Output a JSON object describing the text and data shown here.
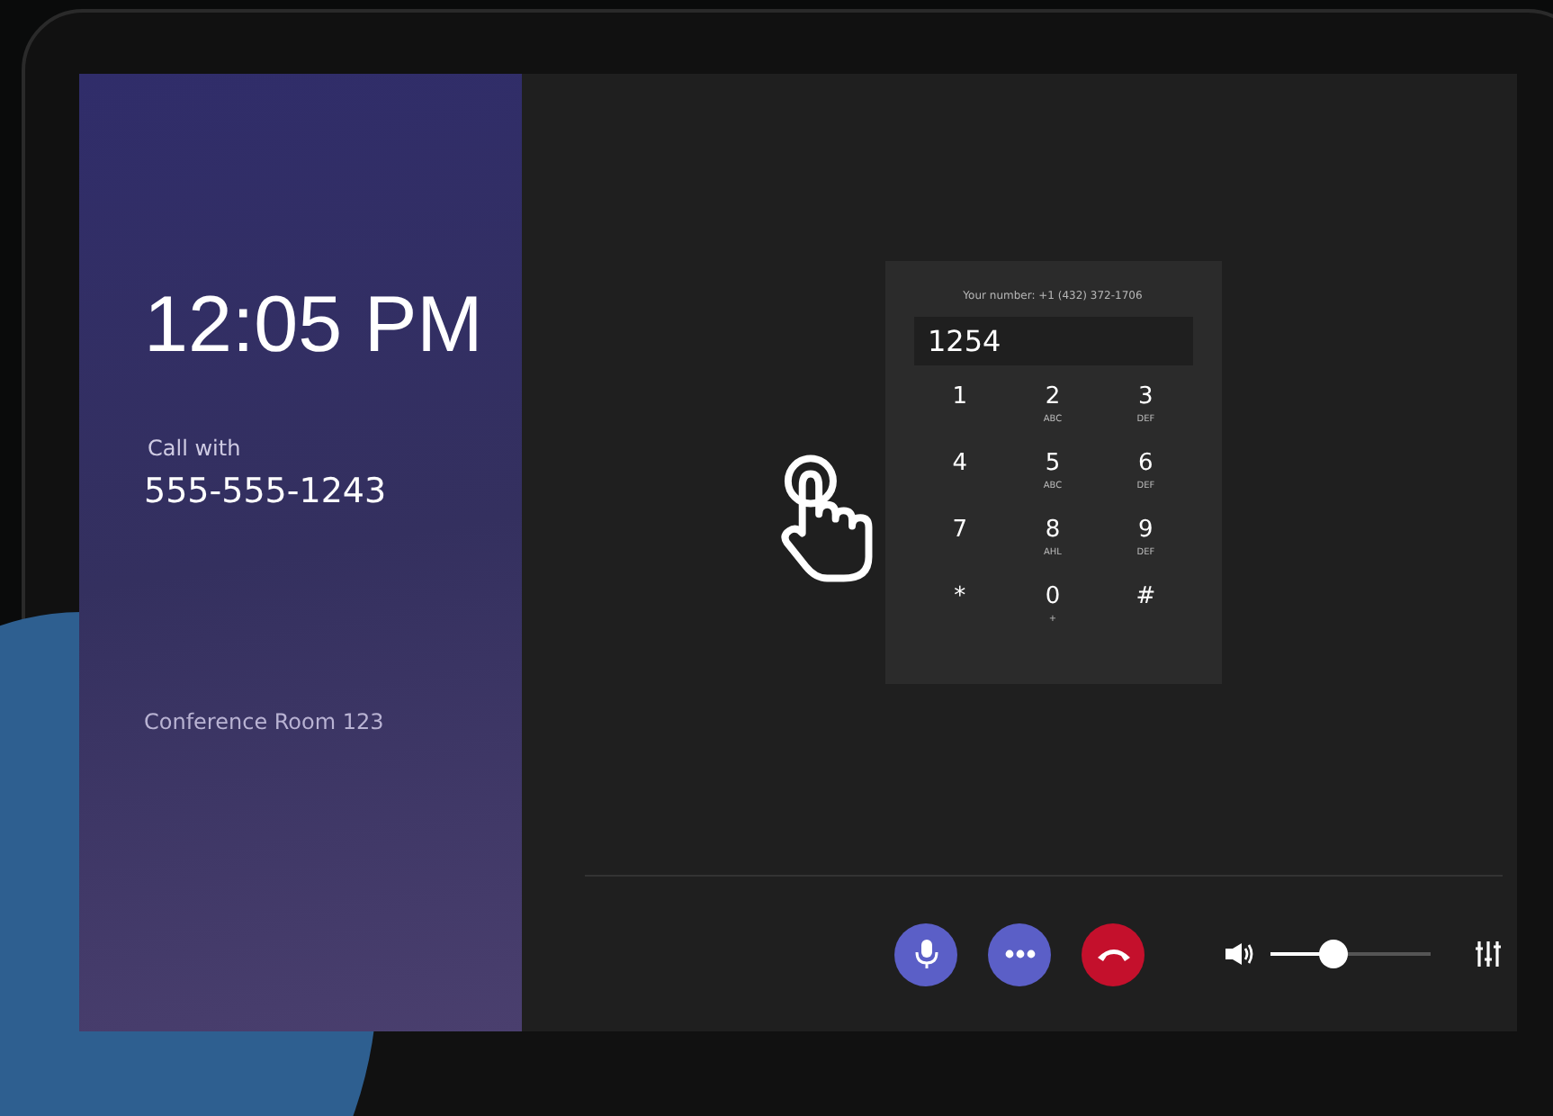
{
  "clock": "12:05 PM",
  "call": {
    "label": "Call with",
    "number": "555-555-1243"
  },
  "room": "Conference Room 123",
  "dialpad": {
    "your_number": "Your number: +1 (432) 372-1706",
    "entry": "1254",
    "keys": [
      {
        "digit": "1"
      },
      {
        "digit": "2",
        "letters": "ABC"
      },
      {
        "digit": "3",
        "letters": "DEF"
      },
      {
        "digit": "4"
      },
      {
        "digit": "5",
        "letters": "ABC"
      },
      {
        "digit": "6",
        "letters": "DEF"
      },
      {
        "digit": "7"
      },
      {
        "digit": "8",
        "letters": "AHL"
      },
      {
        "digit": "9",
        "letters": "DEF"
      },
      {
        "digit": "*"
      },
      {
        "digit": "0",
        "letters": "+"
      },
      {
        "digit": "#"
      }
    ]
  },
  "controls": [
    {
      "kind": "mic"
    },
    {
      "kind": "more"
    },
    {
      "kind": "hangup"
    }
  ],
  "volume": {
    "level": 0.37
  }
}
